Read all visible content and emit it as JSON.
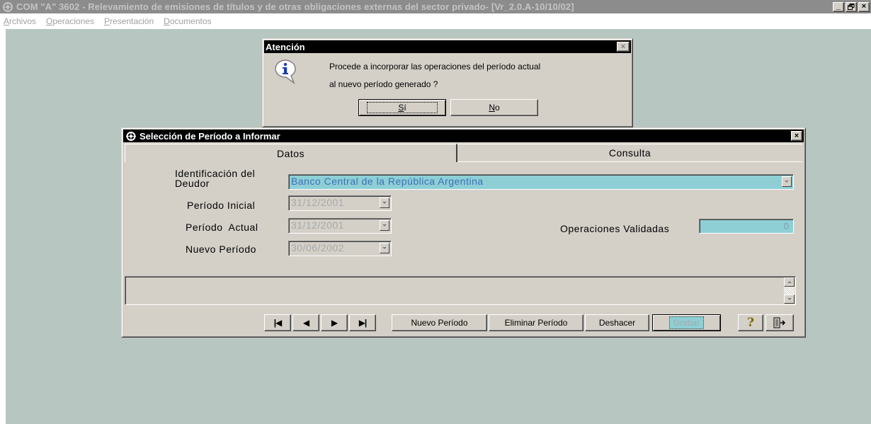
{
  "app": {
    "title": "COM \"A\" 3602 - Relevamiento de emisiones de títulos y de otras obligaciones externas del sector privado- [Vr_2.0.A-10/10/02]",
    "menu": [
      {
        "label": "Archivos",
        "accel": "A",
        "rest": "rchivos"
      },
      {
        "label": "Operaciones",
        "accel": "O",
        "rest": "peraciones"
      },
      {
        "label": "Presentación",
        "accel": "P",
        "rest": "resentación"
      },
      {
        "label": "Documentos",
        "accel": "D",
        "rest": "ocumentos"
      }
    ],
    "caption_buttons": {
      "minimize": "_",
      "restore": "🗗",
      "close": "×"
    }
  },
  "alert": {
    "title": "Atención",
    "close_label": "×",
    "icon": "info-balloon-icon",
    "message_line1": "Procede a incorporar las operaciones del período actual",
    "message_line2": "al nuevo período generado ?",
    "yes": {
      "accel": "S",
      "rest": "í"
    },
    "no": {
      "accel": "N",
      "rest": "o"
    }
  },
  "dialog": {
    "title": "Selección de Período a Informar",
    "close_label": "×",
    "tabs": [
      "Datos",
      "Consulta"
    ],
    "fields": {
      "deudor_label_1": "Identificación del",
      "deudor_label_2": "Deudor",
      "deudor_value": "Banco Central de la República Argentina",
      "periodo_inicial_label": "Período Inicial",
      "periodo_inicial_value": "31/12/2001",
      "periodo_actual_label": "Período  Actual",
      "periodo_actual_value": "31/12/2001",
      "nuevo_periodo_label": "Nuevo Período",
      "nuevo_periodo_value": "30/06/2002",
      "ops_validadas_label": "Operaciones Validadas",
      "ops_validadas_value": "0"
    },
    "toolbar": {
      "first": "|◀",
      "prev": "◀",
      "next": "▶",
      "last": "▶|",
      "nuevo": "Nuevo Período",
      "eliminar": "Eliminar Período",
      "deshacer": "Deshacer",
      "grabar": "Grabar",
      "help": "?",
      "exit_icon": "exit-door-icon"
    }
  },
  "colors": {
    "workspace": "#b7c6c0",
    "window_face": "#d4d0c8",
    "title_active": "#000000",
    "field_cyan": "#8ecfd6",
    "field_text_blue": "#3e6fb6"
  }
}
